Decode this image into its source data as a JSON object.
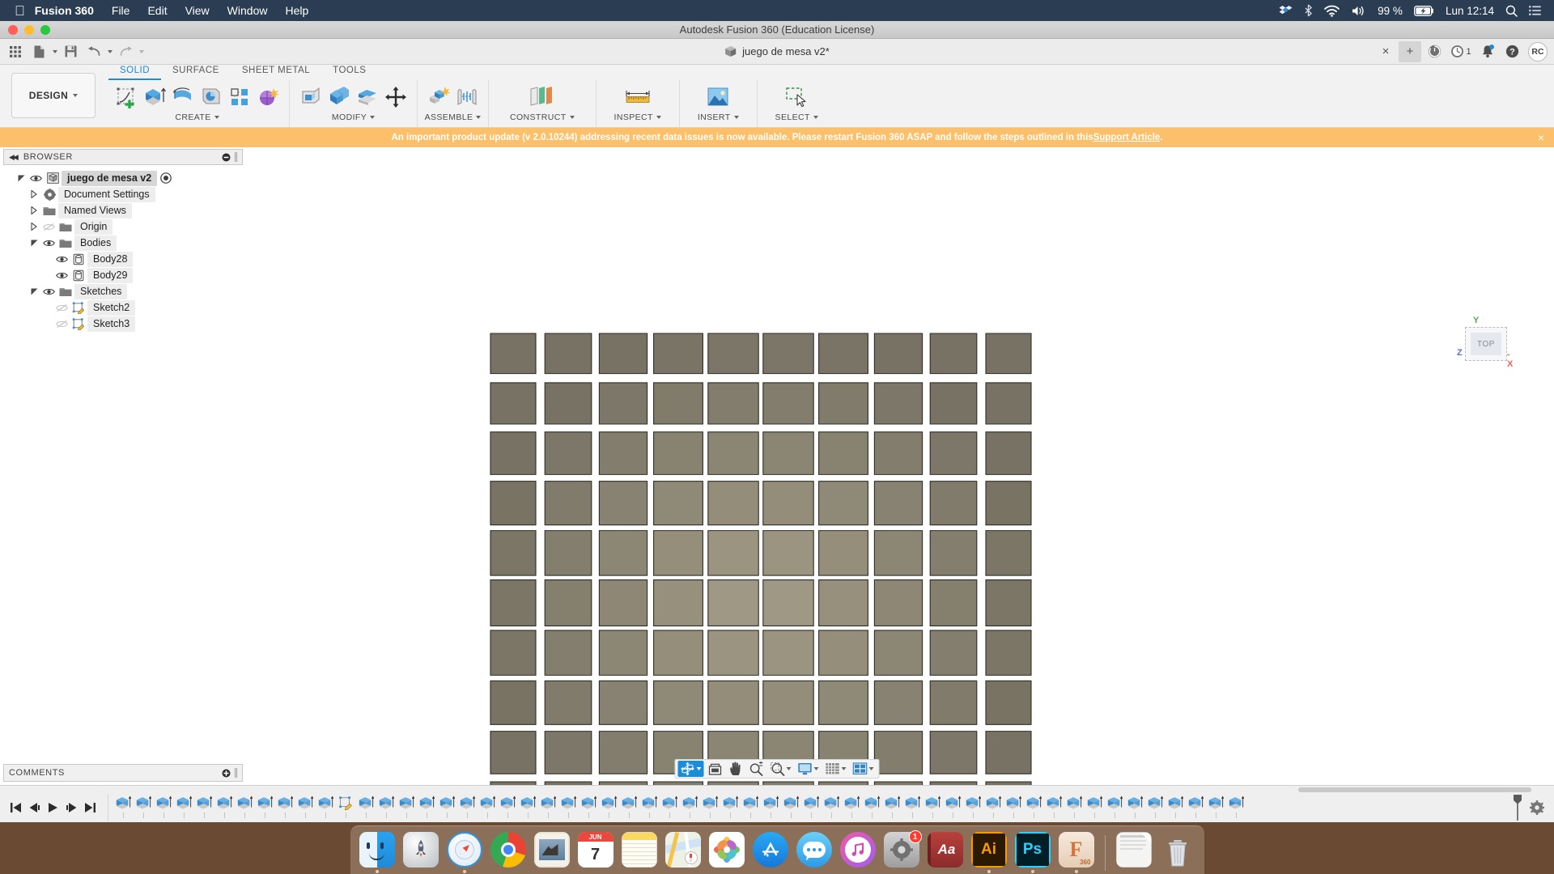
{
  "macbar": {
    "apple_icon": "apple-icon",
    "app_name": "Fusion 360",
    "menus": [
      "File",
      "Edit",
      "View",
      "Window",
      "Help"
    ],
    "status": {
      "battery_percent": "99 %",
      "clock": "Lun 12:14",
      "icons": [
        "dropbox-icon",
        "bluetooth-icon",
        "wifi-icon",
        "volume-icon",
        "battery-charging-icon",
        "spotlight-search-icon",
        "control-center-icon"
      ]
    }
  },
  "window": {
    "title": "Autodesk Fusion 360 (Education License)",
    "traffic_lights": [
      "close",
      "minimize",
      "zoom"
    ]
  },
  "quick_access": {
    "buttons": [
      "show-data-panel-icon",
      "file-icon",
      "save-icon",
      "undo-icon",
      "redo-icon"
    ]
  },
  "document_tab": {
    "label": "juego de mesa v2*",
    "icon": "document-cube-icon",
    "close_label": "×",
    "new_tab_label": "+"
  },
  "tab_controls": {
    "job_status_icon": "job-status-icon",
    "recent_icon": "recent-clock-icon",
    "recent_count": "1",
    "notifications_icon": "bell-icon",
    "help_icon": "help-icon",
    "avatar_initials": "RC"
  },
  "ribbon": {
    "workspace_label": "DESIGN",
    "tabs": [
      {
        "label": "SOLID",
        "active": true
      },
      {
        "label": "SURFACE",
        "active": false
      },
      {
        "label": "SHEET METAL",
        "active": false
      },
      {
        "label": "TOOLS",
        "active": false
      }
    ],
    "panels": [
      {
        "label": "CREATE",
        "has_dropdown": true,
        "tools": [
          "create-sketch-icon",
          "extrude-icon",
          "revolve-icon",
          "sweep-icon",
          "hole-icon",
          "pattern-icon",
          "form-icon"
        ]
      },
      {
        "label": "MODIFY",
        "has_dropdown": true,
        "tools": [
          "press-pull-icon",
          "fillet-icon",
          "shell-icon",
          "move-copy-icon"
        ]
      },
      {
        "label": "ASSEMBLE",
        "has_dropdown": true,
        "tools": [
          "new-component-icon",
          "joint-icon"
        ]
      },
      {
        "label": "CONSTRUCT",
        "has_dropdown": true,
        "tools": [
          "offset-plane-icon"
        ]
      },
      {
        "label": "INSPECT",
        "has_dropdown": true,
        "tools": [
          "measure-icon"
        ]
      },
      {
        "label": "INSERT",
        "has_dropdown": true,
        "tools": [
          "insert-image-icon"
        ]
      },
      {
        "label": "SELECT",
        "has_dropdown": true,
        "tools": [
          "select-window-icon"
        ]
      }
    ]
  },
  "banner": {
    "text_before": "An important product update (v 2.0.10244) addressing recent data issues is now available. Please restart Fusion 360 ASAP and follow the steps outlined in this ",
    "link_text": "Support Article",
    "text_after": ".",
    "close_label": "×",
    "background_color": "#fbc069"
  },
  "browser": {
    "title": "BROWSER",
    "collapse_icon": "collapse-left-icon",
    "minimize_icon": "minimize-circle-icon",
    "tree": [
      {
        "label": "juego de mesa v2",
        "depth": 0,
        "twist": "expanded",
        "eye": "visible",
        "icon": "component-icon",
        "root": true,
        "after": "activate-radio-icon"
      },
      {
        "label": "Document Settings",
        "depth": 1,
        "twist": "collapsed",
        "eye": "none",
        "icon": "gear-icon"
      },
      {
        "label": "Named Views",
        "depth": 1,
        "twist": "collapsed",
        "eye": "none",
        "icon": "folder-icon"
      },
      {
        "label": "Origin",
        "depth": 1,
        "twist": "collapsed",
        "eye": "hidden",
        "icon": "folder-icon"
      },
      {
        "label": "Bodies",
        "depth": 1,
        "twist": "expanded",
        "eye": "visible",
        "icon": "folder-icon"
      },
      {
        "label": "Body28",
        "depth": 2,
        "twist": "none",
        "eye": "visible",
        "icon": "body-icon"
      },
      {
        "label": "Body29",
        "depth": 2,
        "twist": "none",
        "eye": "visible",
        "icon": "body-icon"
      },
      {
        "label": "Sketches",
        "depth": 1,
        "twist": "expanded",
        "eye": "visible",
        "icon": "folder-icon"
      },
      {
        "label": "Sketch2",
        "depth": 2,
        "twist": "none",
        "eye": "hidden",
        "icon": "sketch-icon"
      },
      {
        "label": "Sketch3",
        "depth": 2,
        "twist": "none",
        "eye": "hidden",
        "icon": "sketch-icon"
      }
    ]
  },
  "viewcube": {
    "face_label": "TOP",
    "axis_y": "Y",
    "axis_x": "-X",
    "axis_z": "Z",
    "color_y": "#4caf50",
    "color_x": "#f4615e",
    "color_z": "#5b6ee1"
  },
  "model": {
    "description": "board game grid of square tiles",
    "columns": 10,
    "rows": 11,
    "tile_color": "#a29b87",
    "tile_color_dark": "#8a8373",
    "edge_color": "#2e2c26"
  },
  "navbar": {
    "buttons": [
      {
        "icon": "orbit-icon",
        "active": true,
        "dropdown": true
      },
      {
        "icon": "look-at-icon",
        "active": false,
        "dropdown": false
      },
      {
        "icon": "pan-icon",
        "active": false,
        "dropdown": false
      },
      {
        "icon": "zoom-icon",
        "active": false,
        "dropdown": false
      },
      {
        "icon": "fit-icon",
        "active": false,
        "dropdown": true
      },
      {
        "icon": "display-settings-icon",
        "active": false,
        "dropdown": true
      },
      {
        "icon": "grid-snaps-icon",
        "active": false,
        "dropdown": true
      },
      {
        "icon": "viewports-icon",
        "active": false,
        "dropdown": true
      }
    ]
  },
  "comments": {
    "title": "COMMENTS",
    "add_icon": "add-comment-icon"
  },
  "timeline": {
    "controls": [
      "go-to-beginning-icon",
      "step-back-icon",
      "play-icon",
      "step-forward-icon",
      "go-to-end-icon"
    ],
    "features": [
      "extrude-feature",
      "extrude-feature",
      "extrude-feature",
      "extrude-feature",
      "extrude-feature",
      "extrude-feature",
      "extrude-feature",
      "extrude-feature",
      "extrude-feature",
      "extrude-feature",
      "extrude-feature",
      "sketch-feature",
      "extrude-feature",
      "extrude-feature",
      "extrude-feature",
      "extrude-feature",
      "extrude-feature",
      "extrude-feature",
      "extrude-feature",
      "extrude-feature",
      "extrude-feature",
      "extrude-feature",
      "extrude-feature",
      "extrude-feature",
      "extrude-feature",
      "extrude-feature",
      "extrude-feature",
      "extrude-feature",
      "extrude-feature",
      "extrude-feature",
      "extrude-feature",
      "extrude-feature",
      "extrude-feature",
      "extrude-feature",
      "extrude-feature",
      "extrude-feature",
      "extrude-feature",
      "extrude-feature",
      "extrude-feature",
      "extrude-feature",
      "extrude-feature",
      "extrude-feature",
      "extrude-feature",
      "extrude-feature",
      "extrude-feature",
      "extrude-feature",
      "extrude-feature",
      "extrude-feature",
      "extrude-feature",
      "extrude-feature",
      "extrude-feature",
      "extrude-feature",
      "extrude-feature",
      "extrude-feature",
      "extrude-feature",
      "extrude-feature"
    ],
    "settings_icon": "timeline-settings-icon"
  },
  "dock": {
    "apps": [
      {
        "name": "Finder",
        "icon": "finder-icon",
        "running": true
      },
      {
        "name": "Launchpad",
        "icon": "launchpad-icon",
        "running": false
      },
      {
        "name": "Safari",
        "icon": "safari-icon",
        "running": true
      },
      {
        "name": "Google Chrome",
        "icon": "chrome-icon",
        "running": false
      },
      {
        "name": "Mail",
        "icon": "mail-icon",
        "running": false
      },
      {
        "name": "Calendar",
        "icon": "calendar-icon",
        "running": false,
        "month": "JUN",
        "day": "7"
      },
      {
        "name": "Notes",
        "icon": "notes-icon",
        "running": false
      },
      {
        "name": "Maps",
        "icon": "maps-icon",
        "running": false
      },
      {
        "name": "Photos",
        "icon": "photos-icon",
        "running": false
      },
      {
        "name": "App Store",
        "icon": "app-store-icon",
        "running": false
      },
      {
        "name": "Messages",
        "icon": "messages-icon",
        "running": false
      },
      {
        "name": "iTunes",
        "icon": "itunes-icon",
        "running": false
      },
      {
        "name": "System Preferences",
        "icon": "system-preferences-icon",
        "running": false,
        "badge": "1"
      },
      {
        "name": "Dictionary",
        "icon": "dictionary-icon",
        "running": false,
        "label": "Aa"
      },
      {
        "name": "Adobe Illustrator",
        "icon": "illustrator-icon",
        "running": true,
        "label": "Ai"
      },
      {
        "name": "Adobe Photoshop",
        "icon": "photoshop-icon",
        "running": true,
        "label": "Ps"
      },
      {
        "name": "Fusion 360",
        "icon": "fusion360-icon",
        "running": true,
        "label": "F",
        "sublabel": "360"
      }
    ],
    "extras": [
      {
        "name": "Documents",
        "icon": "documents-stack-icon"
      },
      {
        "name": "Trash",
        "icon": "trash-icon"
      }
    ]
  }
}
